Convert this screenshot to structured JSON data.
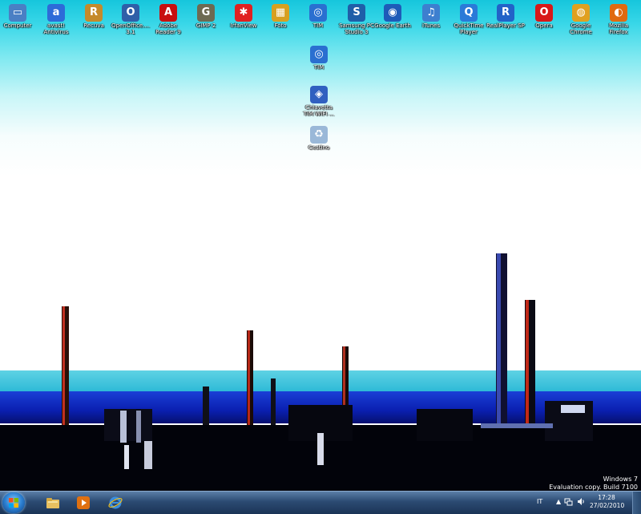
{
  "desktop": {
    "icons": [
      {
        "label": "Computer",
        "icon": "computer-icon",
        "color": "#4a7fc4",
        "glyph": "▭"
      },
      {
        "label": "avast!\nAntivirus",
        "icon": "avast-icon",
        "color": "#2d6bd8",
        "glyph": "a"
      },
      {
        "label": "Recuva",
        "icon": "recuva-icon",
        "color": "#c58a2a",
        "glyph": "R"
      },
      {
        "label": "OpenOffice....\n3.1",
        "icon": "openoffice-icon",
        "color": "#2f5fa8",
        "glyph": "O"
      },
      {
        "label": "Adobe\nReader 9",
        "icon": "adobe-reader-icon",
        "color": "#c81010",
        "glyph": "A"
      },
      {
        "label": "GIMP 2",
        "icon": "gimp-icon",
        "color": "#6d6a52",
        "glyph": "G"
      },
      {
        "label": "IrfanView",
        "icon": "irfanview-icon",
        "color": "#e02020",
        "glyph": "✱"
      },
      {
        "label": "Foto",
        "icon": "photo-icon",
        "color": "#d8a020",
        "glyph": "▦"
      },
      {
        "label": "TIM",
        "icon": "tim-icon",
        "color": "#2a6fd0",
        "glyph": "◎"
      },
      {
        "label": "Samsung PC\nStudio 3",
        "icon": "samsung-pc-studio-icon",
        "color": "#1f5ea8",
        "glyph": "S"
      },
      {
        "label": "Google Earth",
        "icon": "google-earth-icon",
        "color": "#1e5bb8",
        "glyph": "◉"
      },
      {
        "label": "iTunes",
        "icon": "itunes-icon",
        "color": "#3d7fcf",
        "glyph": "♫"
      },
      {
        "label": "QuickTime\nPlayer",
        "icon": "quicktime-icon",
        "color": "#2a7ad8",
        "glyph": "Q"
      },
      {
        "label": "RealPlayer SP",
        "icon": "realplayer-icon",
        "color": "#2262c8",
        "glyph": "R"
      },
      {
        "label": "Opera",
        "icon": "opera-icon",
        "color": "#d81818",
        "glyph": "O"
      },
      {
        "label": "Google\nChrome",
        "icon": "chrome-icon",
        "color": "#e0a020",
        "glyph": "◍"
      },
      {
        "label": "Mozilla\nFirefox",
        "icon": "firefox-icon",
        "color": "#e06a10",
        "glyph": "◐"
      },
      {
        "label": "TIM",
        "icon": "tim-icon",
        "color": "#2a6fd0",
        "glyph": "◎"
      },
      {
        "label": "Chiavetta\nTIM WIFI ...",
        "icon": "tim-usb-key-icon",
        "color": "#3060c0",
        "glyph": "◈"
      },
      {
        "label": "Cestino",
        "icon": "recycle-bin-icon",
        "color": "#9ab8d8",
        "glyph": "♻"
      }
    ],
    "watermark": {
      "line1": "Windows 7",
      "line2": "Evaluation copy. Build 7100"
    }
  },
  "taskbar": {
    "pinned": [
      {
        "name": "explorer",
        "icon": "folder-icon",
        "color": "#e8c060"
      },
      {
        "name": "media-player",
        "icon": "media-player-icon",
        "color": "#e07010"
      },
      {
        "name": "internet-explorer",
        "icon": "internet-explorer-icon",
        "color": "#3a8ee0"
      }
    ],
    "tray": {
      "language": "IT",
      "time": "17:28",
      "date": "27/02/2010"
    }
  }
}
